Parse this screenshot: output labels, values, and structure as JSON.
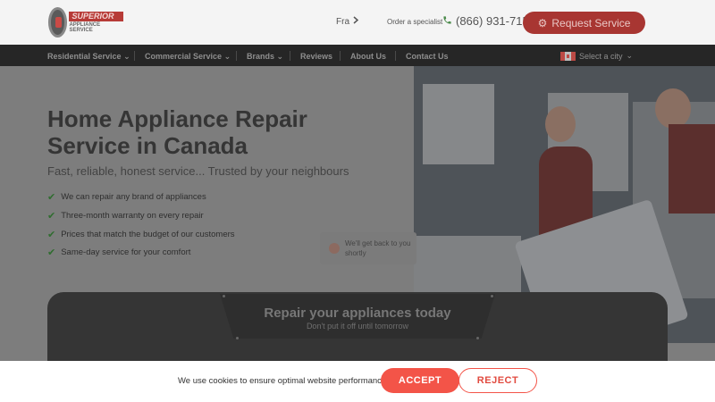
{
  "header": {
    "logo": {
      "title": "SUPERIOR",
      "subtitle": "APPLIANCE SERVICE"
    },
    "language": "Fra",
    "order_label": "Order a specialist",
    "phone": "(866) 931-7158",
    "request_button": "Request Service"
  },
  "nav": {
    "items": [
      {
        "label": "Residential Service",
        "dropdown": true
      },
      {
        "label": "Commercial Service",
        "dropdown": true
      },
      {
        "label": "Brands",
        "dropdown": true
      },
      {
        "label": "Reviews",
        "dropdown": false
      },
      {
        "label": "About Us",
        "dropdown": false
      },
      {
        "label": "Contact Us",
        "dropdown": false
      }
    ],
    "city_selector": "Select a city"
  },
  "hero": {
    "title_line1": "Home Appliance Repair",
    "title_line2": "Service in Canada",
    "subtitle": "Fast, reliable, honest service... Trusted by your neighbours",
    "features": [
      "We can repair any brand of appliances",
      "Three-month warranty on every repair",
      "Prices that match the budget of our customers",
      "Same-day service for your comfort"
    ]
  },
  "chat_widget": {
    "text": "We'll get back to you shortly"
  },
  "banner": {
    "title": "Repair your appliances today",
    "subtitle": "Don't put it off until tomorrow"
  },
  "cookie": {
    "text": "We use cookies to ensure optimal website performance",
    "accept": "ACCEPT",
    "reject": "REJECT"
  },
  "colors": {
    "accent": "#f35448",
    "nav_bg": "#262626",
    "overlay": "#7d7d7d"
  }
}
